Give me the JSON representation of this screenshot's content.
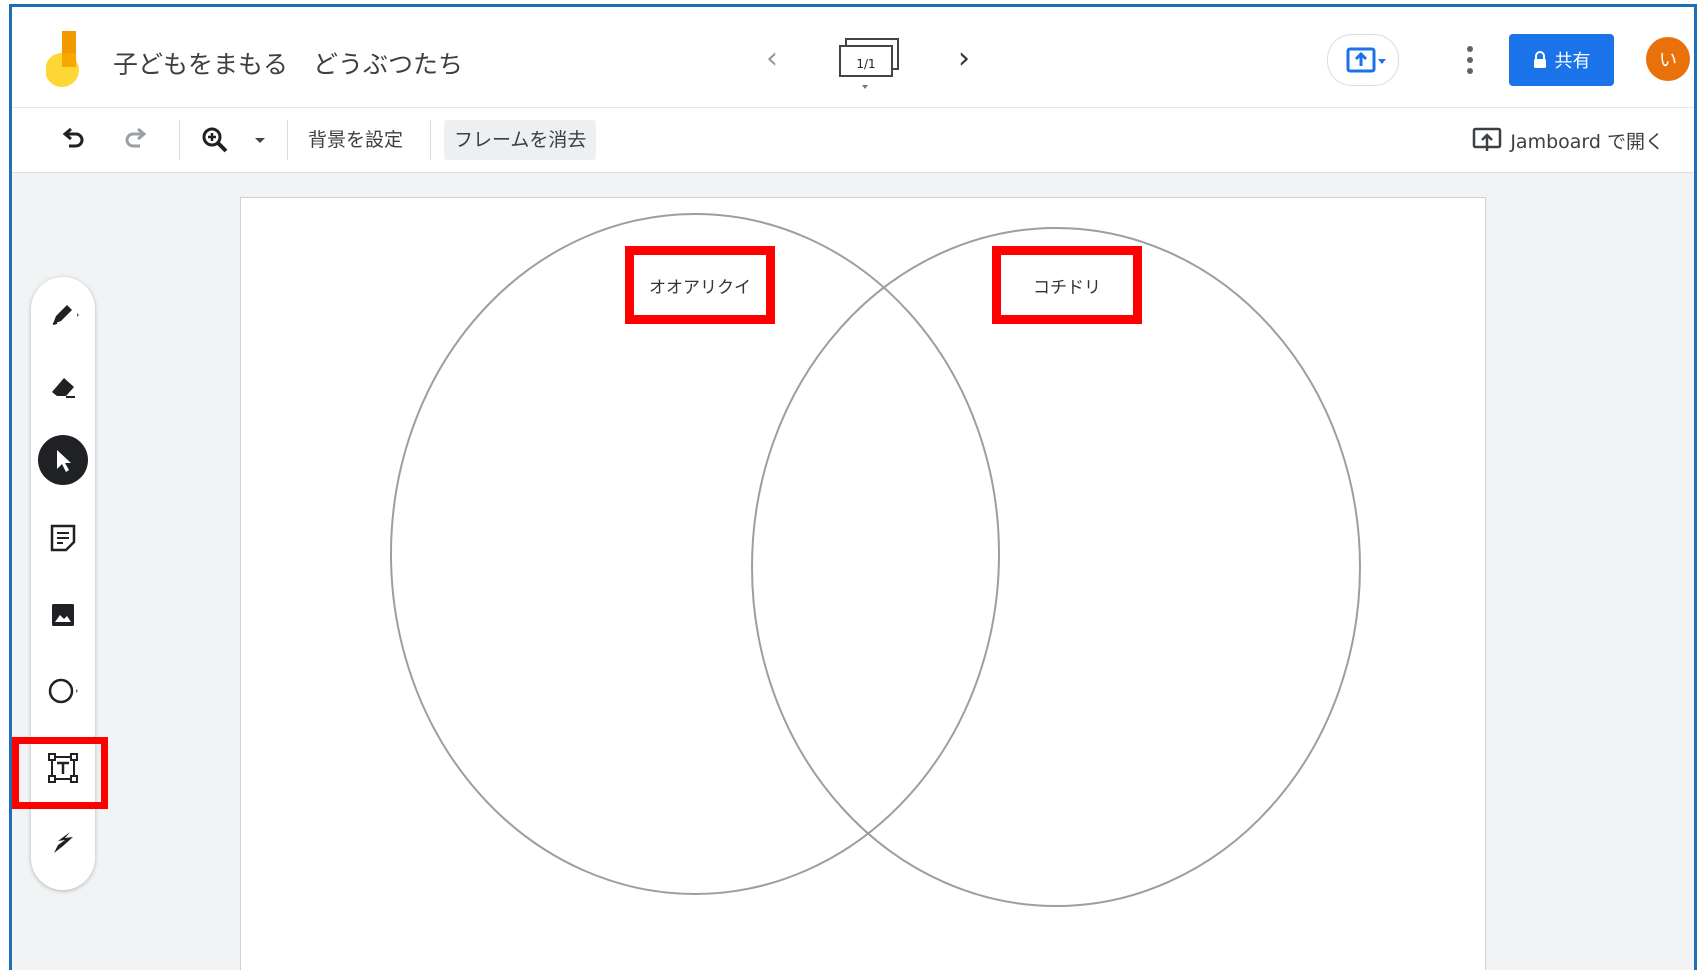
{
  "header": {
    "title": "子どもをまもる　どうぶつたち",
    "frame_counter": "1/1",
    "share_label": "共有",
    "avatar_initial": "い"
  },
  "toolbar": {
    "set_background": "背景を設定",
    "clear_frame": "フレームを消去",
    "open_in_jamboard": "Jamboard で開く"
  },
  "side_tools": [
    {
      "name": "pen-icon"
    },
    {
      "name": "eraser-icon"
    },
    {
      "name": "select-icon",
      "selected": true
    },
    {
      "name": "sticky-note-icon"
    },
    {
      "name": "image-icon"
    },
    {
      "name": "circle-shape-icon"
    },
    {
      "name": "text-box-icon",
      "highlighted": true
    },
    {
      "name": "laser-icon"
    }
  ],
  "canvas": {
    "left_label": "オオアリクイ",
    "right_label": "コチドリ"
  },
  "colors": {
    "accent": "#1a73e8",
    "avatar": "#e8710a",
    "highlight": "#ff0000"
  }
}
